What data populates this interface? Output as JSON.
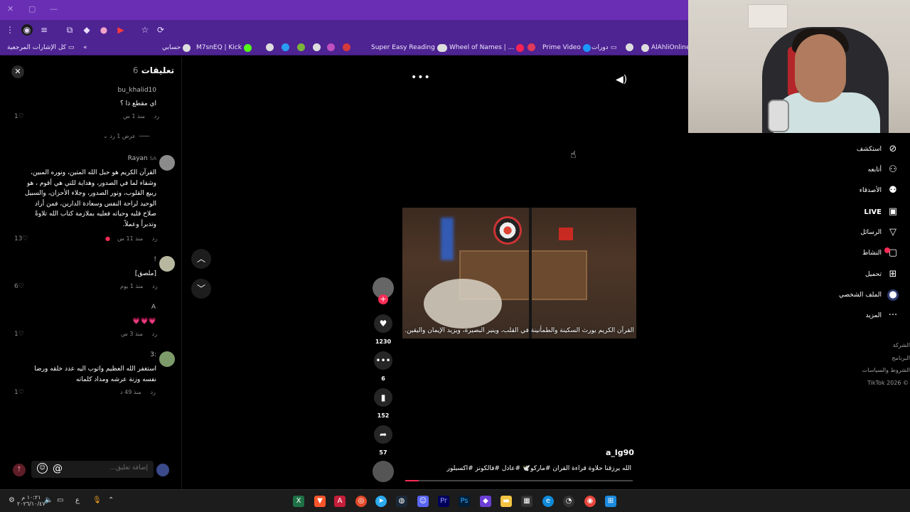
{
  "browser": {
    "bookmarks": [
      "كل الإشارات المرجعية",
      "حسابي",
      "M7snEQ | Kick",
      "Super Easy Reading",
      "Wheel of Names | ...",
      "Prime Video",
      "دورات",
      "AlAhliOnline"
    ]
  },
  "comments": {
    "title": "تعليقات",
    "count": "6",
    "items": [
      {
        "user": "bu_khalid10",
        "text": "اي مقطع ذا ؟",
        "time": "منذ 1 س",
        "reply": "رد",
        "likes": "1"
      },
      {
        "user": "Rayan",
        "flag": "SA",
        "text": "القرآن الكريم هو حبل الله المتين، ونوره المبين، وشفاء لما في الصدور، وهداية للتي هي أقوم ، هو ربيع القلوب، ونور الصدور، وجلاء الأحزان، والسبيل الوحيد لراحة النفس وسعادة الدارين، فمن أراد صلاح قلبه وحياته فعليه بملازمة كتاب الله تلاوةً وتدبراً وعملاً.",
        "time": "منذ 11 س",
        "reply": "رد",
        "likes": "13"
      },
      {
        "user": "!",
        "text": "[ملصق]",
        "time": "منذ 1 يوم",
        "reply": "رد",
        "likes": "6"
      },
      {
        "user": "A",
        "text": "💗💗💗",
        "time": "منذ 3 س",
        "reply": "رد",
        "likes": "1"
      },
      {
        "user": ":3",
        "text": "استغفر الله العظيم واتوب اليه عدد خلقه ورضا نفسه وزنة عرشه ومداد كلماته",
        "time": "منذ 49 د",
        "reply": "رد",
        "likes": "1"
      }
    ],
    "view_replies": "عرض 1 رد",
    "input_placeholder": "إضافة تعليق...",
    "at_symbol": "@"
  },
  "video": {
    "caption": "القرآن الكريم يورث السكينة والطمأنينة في القلب، وينير البصيرة، ويزيد الإيمان واليقين.",
    "author": "a_lg90",
    "description": "الله يرزقنا حلاوة قراءة القران #ماركو🕊️ #عادل #فالكونز #اكسبلور",
    "likes": "1230",
    "comments": "6",
    "saves": "152",
    "shares": "57",
    "progress": 0.06
  },
  "sidebar": {
    "items": [
      {
        "label": "استكشف",
        "icon": "compass-icon"
      },
      {
        "label": "أتابعه",
        "icon": "user-follow-icon"
      },
      {
        "label": "الأصدقاء",
        "icon": "friends-icon"
      },
      {
        "label": "LIVE",
        "icon": "live-icon"
      },
      {
        "label": "الرسائل",
        "icon": "send-icon"
      },
      {
        "label": "النشاط",
        "icon": "activity-icon"
      },
      {
        "label": "تحميل",
        "icon": "upload-icon"
      },
      {
        "label": "الملف الشخصي",
        "icon": "profile-icon"
      },
      {
        "label": "المزيد",
        "icon": "more-icon"
      }
    ],
    "footer": [
      "الشركة",
      "البرنامج",
      "الشروط والسياسات",
      "© 2026 TikTok"
    ]
  },
  "taskbar": {
    "time": "١٠:٢١ م",
    "date": "٢٠٢٦/١٠/٤٧",
    "lang": "ع"
  },
  "colors": {
    "accent": "#fe2c55",
    "browser_purple": "#4e2392"
  }
}
